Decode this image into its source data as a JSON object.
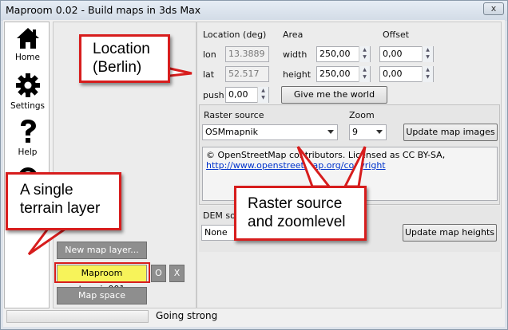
{
  "window": {
    "title": "Maproom 0.02 - Build maps in 3ds Max",
    "close_glyph": "x"
  },
  "sidebar": {
    "items": [
      {
        "label": "Home",
        "icon": "home-icon"
      },
      {
        "label": "Settings",
        "icon": "gear-icon"
      },
      {
        "label": "Help",
        "icon": "question-icon"
      }
    ]
  },
  "layers": {
    "new_layer_label": "New map layer...",
    "selected_layer_label": "Maproom terrain001",
    "layer_o_label": "O",
    "layer_x_label": "X",
    "map_space_label": "Map space"
  },
  "location": {
    "heading": "Location (deg)",
    "lon_label": "lon",
    "lon_value": "13.3889",
    "lat_label": "lat",
    "lat_value": "52.517",
    "push_label": "push",
    "push_value": "0,00"
  },
  "area": {
    "heading": "Area",
    "width_label": "width",
    "width_value": "250,00",
    "height_label": "height",
    "height_value": "250,00",
    "world_button": "Give me the world"
  },
  "offset": {
    "heading": "Offset",
    "x_value": "0,00",
    "y_value": "0,00"
  },
  "raster": {
    "heading": "Raster source",
    "source_value": "OSMmapnik",
    "zoom_heading": "Zoom",
    "zoom_value": "9",
    "update_button": "Update map images",
    "attribution_text": "© OpenStreetMap contributors. Licensed as CC BY-SA,",
    "attribution_link": "http://www.openstreetmap.org/copyright"
  },
  "dem": {
    "heading": "DEM so",
    "source_value": "None",
    "update_button": "Update map heights"
  },
  "status": {
    "text": "Going strong"
  },
  "callouts": {
    "location_line1": "Location",
    "location_line2": "(Berlin)",
    "terrain_line1": "A single",
    "terrain_line2": "terrain layer",
    "raster_line1": "Raster source",
    "raster_line2": "and zoomlevel"
  },
  "colors": {
    "callout_border": "#d71d1d",
    "selected_layer_bg": "#f7f35a",
    "link": "#0033cc"
  }
}
